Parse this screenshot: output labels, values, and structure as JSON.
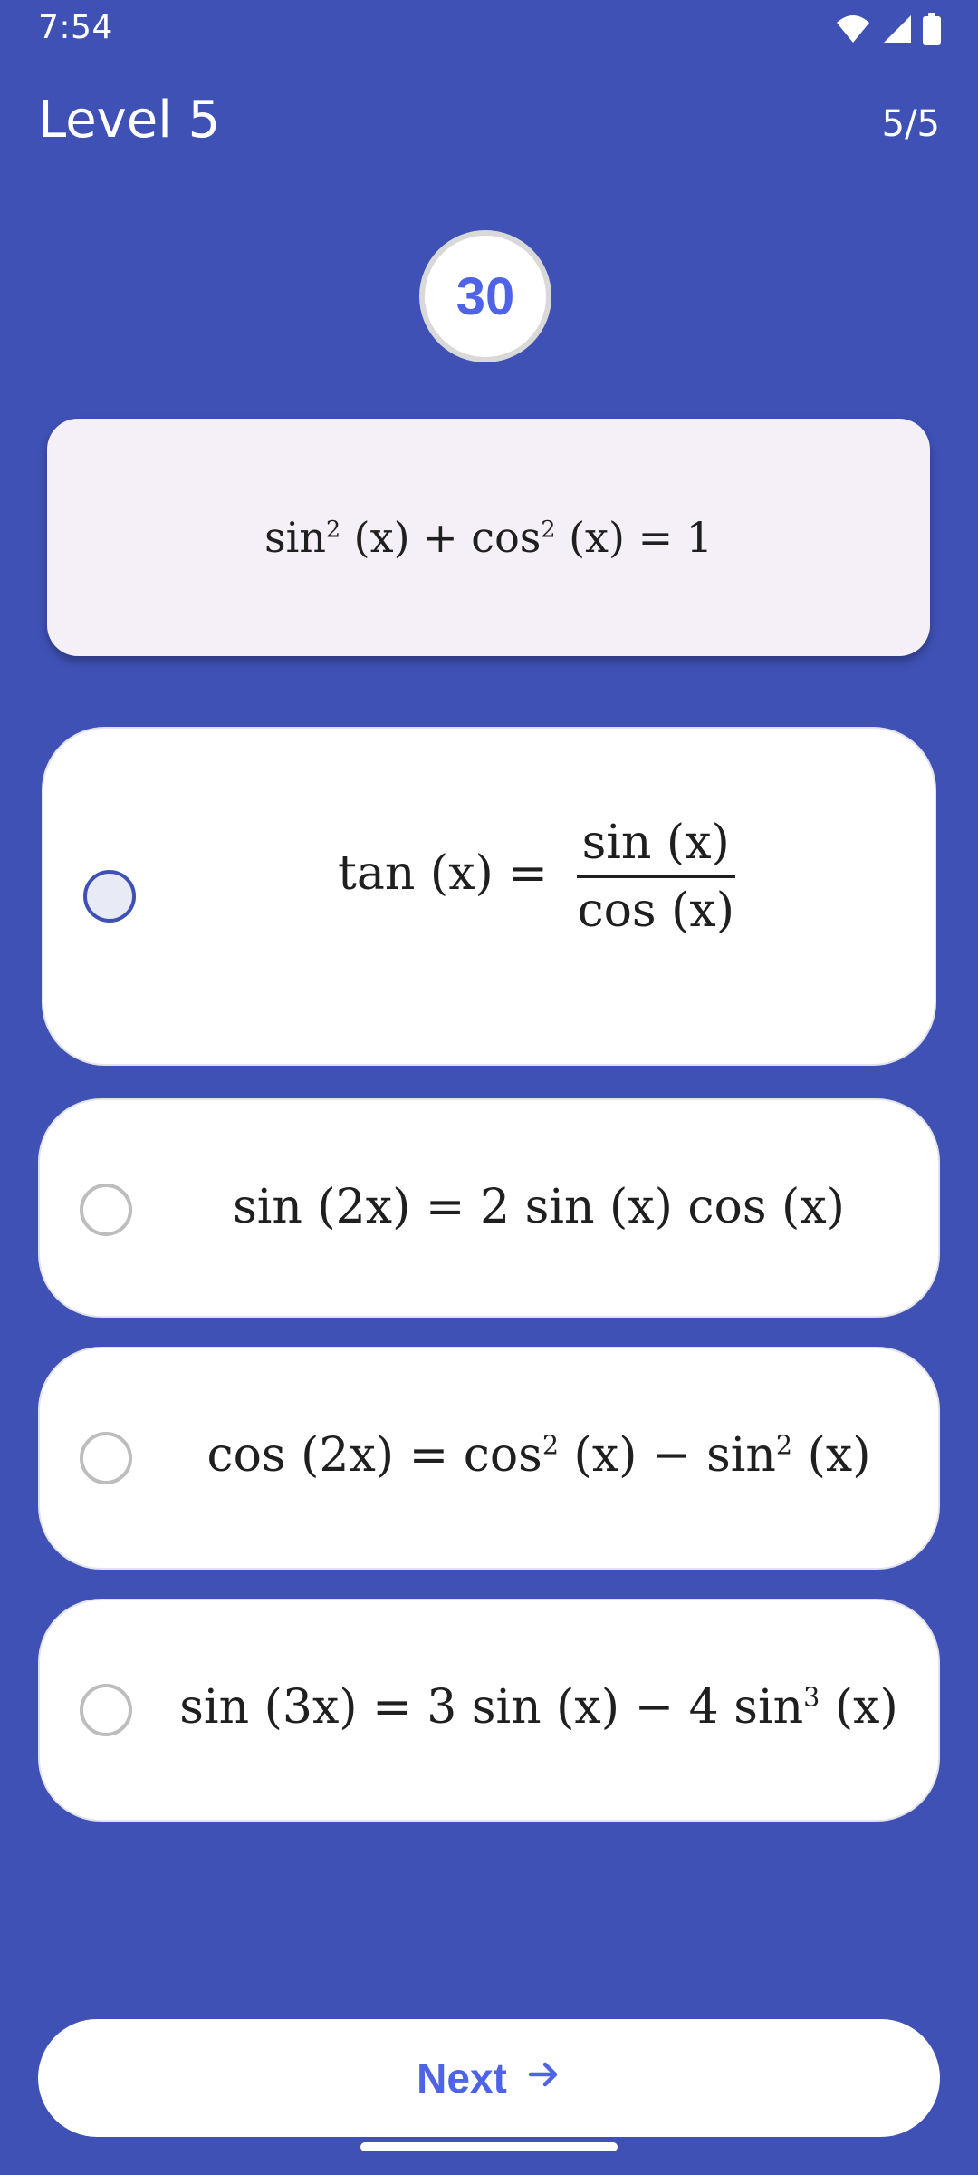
{
  "status_bar": {
    "time": "7:54",
    "icons": [
      "wifi-icon",
      "signal-icon",
      "battery-icon"
    ]
  },
  "header": {
    "level_title": "Level 5",
    "progress": "5/5"
  },
  "timer": {
    "value": "30"
  },
  "question": {
    "left_a": "sin",
    "exp_a": "2",
    "arg_a": " (x) + cos",
    "exp_b": "2",
    "arg_b": " (x) = 1"
  },
  "options": [
    {
      "lhs": "tan (x) =",
      "numerator": "sin (x)",
      "denominator": "cos (x)",
      "selected": true
    },
    {
      "text": "sin (2x) = 2 sin (x) cos (x)",
      "selected": false
    },
    {
      "part1": "cos (2x) = cos",
      "exp1": "2",
      "part2": " (x) − sin",
      "exp2": "2",
      "part3": " (x)",
      "selected": false
    },
    {
      "part1": "sin (3x) = 3 sin (x) − 4 sin",
      "exp1": "3",
      "part2": " (x)",
      "selected": false
    }
  ],
  "next_button": {
    "label": "Next",
    "icon": "arrow-right-icon"
  },
  "colors": {
    "background": "#3f51b5",
    "accent": "#4f63e6",
    "card": "#f5f0f7",
    "option": "#ffffff"
  }
}
